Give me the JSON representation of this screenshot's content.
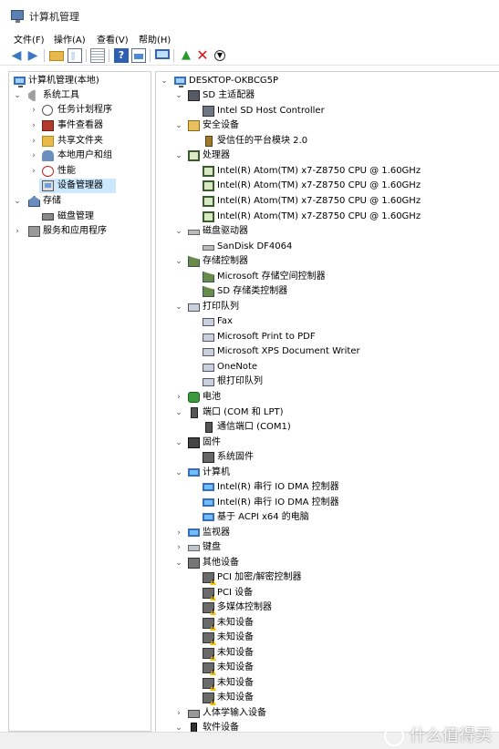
{
  "window": {
    "title": "计算机管理"
  },
  "menu": {
    "items": [
      "文件(F)",
      "操作(A)",
      "查看(V)",
      "帮助(H)"
    ]
  },
  "left_tree": {
    "root": "计算机管理(本地)",
    "system_tools": "系统工具",
    "task_scheduler": "任务计划程序",
    "event_viewer": "事件查看器",
    "shared_folders": "共享文件夹",
    "local_users": "本地用户和组",
    "performance": "性能",
    "device_manager": "设备管理器",
    "storage": "存储",
    "disk_management": "磁盘管理",
    "services": "服务和应用程序"
  },
  "device_tree": {
    "root": "DESKTOP-OKBCG5P",
    "sd_host": "SD 主适配器",
    "sd_host_ctrl": "Intel SD Host Controller",
    "security": "安全设备",
    "tpm": "受信任的平台模块 2.0",
    "processors": "处理器",
    "cpu": "Intel(R) Atom(TM) x7-Z8750  CPU @ 1.60GHz",
    "disk_drives": "磁盘驱动器",
    "disk": "SanDisk DF4064",
    "storage_ctrl": "存储控制器",
    "ms_storage": "Microsoft 存储空间控制器",
    "sd_storage": "SD 存储类控制器",
    "print_queue": "打印队列",
    "fax": "Fax",
    "ms_pdf": "Microsoft Print to PDF",
    "ms_xps": "Microsoft XPS Document Writer",
    "onenote": "OneNote",
    "root_print": "根打印队列",
    "battery": "电池",
    "ports": "端口 (COM 和 LPT)",
    "com1": "通信端口 (COM1)",
    "firmware": "固件",
    "sys_firmware": "系统固件",
    "computer": "计算机",
    "dma": "Intel(R) 串行 IO DMA 控制器",
    "acpi": "基于 ACPI x64 的电脑",
    "monitors": "监视器",
    "keyboard": "键盘",
    "other": "其他设备",
    "pci_crypto": "PCI 加密/解密控制器",
    "pci_dev": "PCI 设备",
    "multimedia": "多媒体控制器",
    "unknown": "未知设备",
    "hid": "人体学输入设备",
    "software": "软件设备"
  },
  "watermark": {
    "text": "什么值得买"
  },
  "colors": {
    "selection": "#cce8ff",
    "accent": "#3b78c4"
  }
}
